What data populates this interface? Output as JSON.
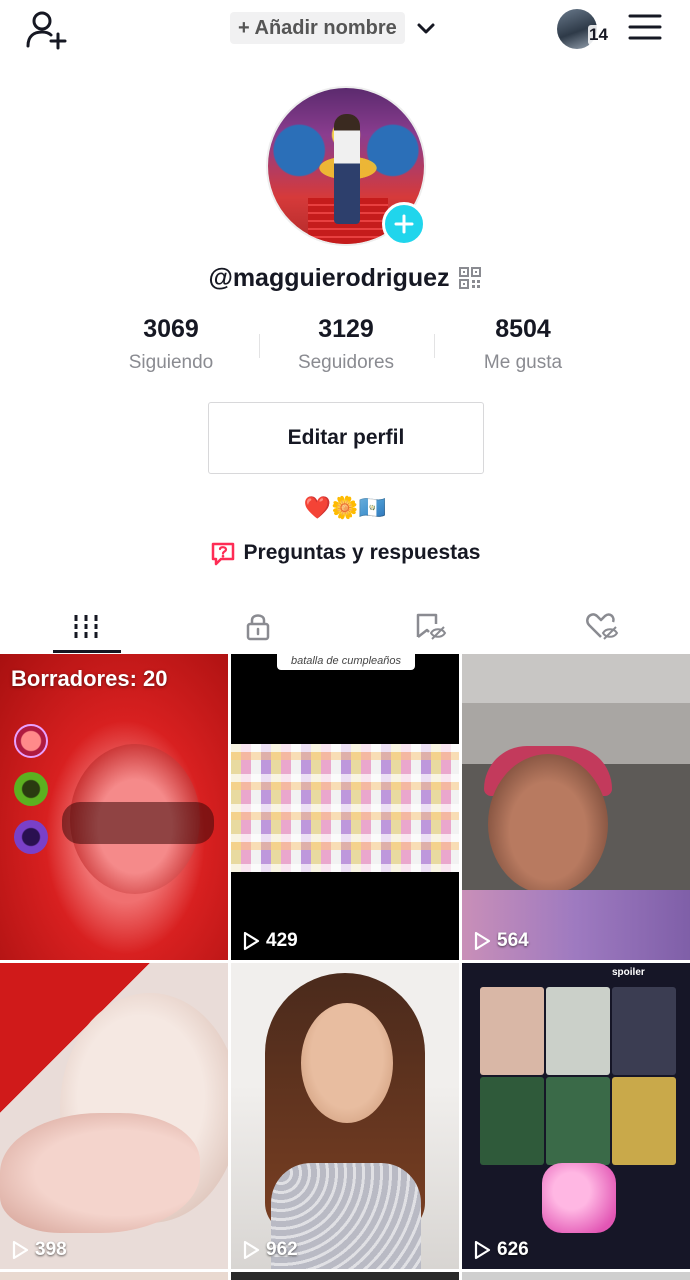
{
  "header": {
    "add_name_label": "+ Añadir nombre",
    "notification_count": "14"
  },
  "profile": {
    "username": "@magguierodriguez",
    "stats": [
      {
        "value": "3069",
        "label": "Siguiendo"
      },
      {
        "value": "3129",
        "label": "Seguidores"
      },
      {
        "value": "8504",
        "label": "Me gusta"
      }
    ],
    "edit_button_label": "Editar perfil",
    "bio": "❤️🌼🇬🇹",
    "qa_label": "Preguntas y respuestas"
  },
  "tabs": [
    {
      "icon": "videos-grid-icon",
      "active": true
    },
    {
      "icon": "lock-icon",
      "active": false
    },
    {
      "icon": "hidden-favorites-icon",
      "active": false
    },
    {
      "icon": "hidden-liked-icon",
      "active": false
    }
  ],
  "videos": [
    {
      "drafts_label": "Borradores: 20"
    },
    {
      "views": "429",
      "banner_text": "batalla de cumpleaños"
    },
    {
      "views": "564"
    },
    {
      "views": "398"
    },
    {
      "views": "962"
    },
    {
      "views": "626",
      "overlay_text": "spoiler"
    }
  ],
  "colors": {
    "accent_cyan": "#20d5ec",
    "qa_pink": "#fe2c55",
    "text_primary": "#161823",
    "text_secondary": "#8a8b91"
  }
}
